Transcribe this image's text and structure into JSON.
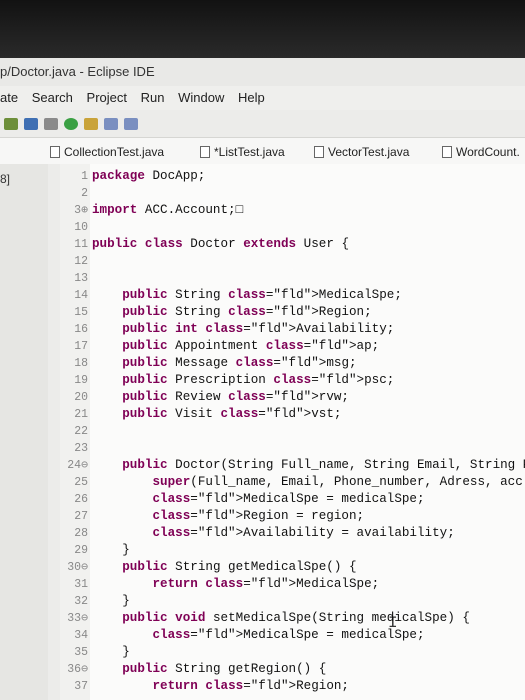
{
  "window": {
    "title": "p/Doctor.java - Eclipse IDE"
  },
  "menu": [
    "ate",
    "Search",
    "Project",
    "Run",
    "Window",
    "Help"
  ],
  "tabs": [
    {
      "label": "CollectionTest.java"
    },
    {
      "label": "*ListTest.java"
    },
    {
      "label": "VectorTest.java"
    },
    {
      "label": "WordCount."
    }
  ],
  "leftpane": {
    "label": "8]"
  },
  "editor": {
    "lines": [
      {
        "n": "1",
        "code": "package DocApp;"
      },
      {
        "n": "2",
        "code": ""
      },
      {
        "n": "3⊕",
        "code": "import ACC.Account;□"
      },
      {
        "n": "10",
        "code": ""
      },
      {
        "n": "11",
        "code": "public class Doctor extends User {"
      },
      {
        "n": "12",
        "code": ""
      },
      {
        "n": "13",
        "code": ""
      },
      {
        "n": "14",
        "code": "    public String MedicalSpe;"
      },
      {
        "n": "15",
        "code": "    public String Region;"
      },
      {
        "n": "16",
        "code": "    public int Availability;"
      },
      {
        "n": "17",
        "code": "    public Appointment ap;"
      },
      {
        "n": "18",
        "code": "    public Message msg;"
      },
      {
        "n": "19",
        "code": "    public Prescription psc;"
      },
      {
        "n": "20",
        "code": "    public Review rvw;"
      },
      {
        "n": "21",
        "code": "    public Visit vst;"
      },
      {
        "n": "22",
        "code": ""
      },
      {
        "n": "23",
        "code": ""
      },
      {
        "n": "24⊖",
        "code": "    public Doctor(String Full_name, String Email, String P"
      },
      {
        "n": "25",
        "code": "        super(Full_name, Email, Phone_number, Adress, acc"
      },
      {
        "n": "26",
        "code": "        MedicalSpe = medicalSpe;"
      },
      {
        "n": "27",
        "code": "        Region = region;"
      },
      {
        "n": "28",
        "code": "        Availability = availability;"
      },
      {
        "n": "29",
        "code": "    }"
      },
      {
        "n": "30⊖",
        "code": "    public String getMedicalSpe() {"
      },
      {
        "n": "31",
        "code": "        return MedicalSpe;"
      },
      {
        "n": "32",
        "code": "    }"
      },
      {
        "n": "33⊖",
        "code": "    public void setMedicalSpe(String medicalSpe) {"
      },
      {
        "n": "34",
        "code": "        MedicalSpe = medicalSpe;"
      },
      {
        "n": "35",
        "code": "    }"
      },
      {
        "n": "36⊖",
        "code": "    public String getRegion() {"
      },
      {
        "n": "37",
        "code": "        return Region;"
      }
    ]
  },
  "colors": {
    "keyword": "#7f0055",
    "field": "#1f3cc8"
  },
  "icons": [
    "new-icon",
    "save-icon",
    "debug-icon",
    "run-icon",
    "search-icon",
    "nav-back-icon",
    "nav-forward-icon"
  ]
}
